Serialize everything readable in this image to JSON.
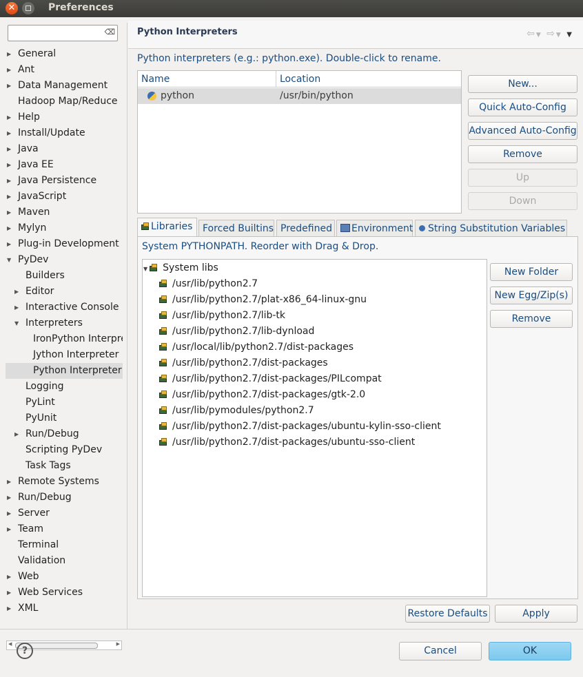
{
  "window": {
    "title": "Preferences"
  },
  "filter": {
    "placeholder": ""
  },
  "tree": [
    {
      "label": "General",
      "indent": 0,
      "arrow": "right"
    },
    {
      "label": "Ant",
      "indent": 0,
      "arrow": "right"
    },
    {
      "label": "Data Management",
      "indent": 0,
      "arrow": "right"
    },
    {
      "label": "Hadoop Map/Reduce",
      "indent": 0,
      "arrow": ""
    },
    {
      "label": "Help",
      "indent": 0,
      "arrow": "right"
    },
    {
      "label": "Install/Update",
      "indent": 0,
      "arrow": "right"
    },
    {
      "label": "Java",
      "indent": 0,
      "arrow": "right"
    },
    {
      "label": "Java EE",
      "indent": 0,
      "arrow": "right"
    },
    {
      "label": "Java Persistence",
      "indent": 0,
      "arrow": "right"
    },
    {
      "label": "JavaScript",
      "indent": 0,
      "arrow": "right"
    },
    {
      "label": "Maven",
      "indent": 0,
      "arrow": "right"
    },
    {
      "label": "Mylyn",
      "indent": 0,
      "arrow": "right"
    },
    {
      "label": "Plug-in Development",
      "indent": 0,
      "arrow": "right"
    },
    {
      "label": "PyDev",
      "indent": 0,
      "arrow": "down"
    },
    {
      "label": "Builders",
      "indent": 1,
      "arrow": ""
    },
    {
      "label": "Editor",
      "indent": 1,
      "arrow": "right"
    },
    {
      "label": "Interactive Console",
      "indent": 1,
      "arrow": "right"
    },
    {
      "label": "Interpreters",
      "indent": 1,
      "arrow": "down"
    },
    {
      "label": "IronPython Interpreter",
      "indent": 2,
      "arrow": ""
    },
    {
      "label": "Jython Interpreter",
      "indent": 2,
      "arrow": ""
    },
    {
      "label": "Python Interpreter",
      "indent": 2,
      "arrow": "",
      "selected": true
    },
    {
      "label": "Logging",
      "indent": 1,
      "arrow": ""
    },
    {
      "label": "PyLint",
      "indent": 1,
      "arrow": ""
    },
    {
      "label": "PyUnit",
      "indent": 1,
      "arrow": ""
    },
    {
      "label": "Run/Debug",
      "indent": 1,
      "arrow": "right"
    },
    {
      "label": "Scripting PyDev",
      "indent": 1,
      "arrow": ""
    },
    {
      "label": "Task Tags",
      "indent": 1,
      "arrow": ""
    },
    {
      "label": "Remote Systems",
      "indent": 0,
      "arrow": "right"
    },
    {
      "label": "Run/Debug",
      "indent": 0,
      "arrow": "right"
    },
    {
      "label": "Server",
      "indent": 0,
      "arrow": "right"
    },
    {
      "label": "Team",
      "indent": 0,
      "arrow": "right"
    },
    {
      "label": "Terminal",
      "indent": 0,
      "arrow": ""
    },
    {
      "label": "Validation",
      "indent": 0,
      "arrow": ""
    },
    {
      "label": "Web",
      "indent": 0,
      "arrow": "right"
    },
    {
      "label": "Web Services",
      "indent": 0,
      "arrow": "right"
    },
    {
      "label": "XML",
      "indent": 0,
      "arrow": "right"
    }
  ],
  "page": {
    "title": "Python Interpreters",
    "description": "Python interpreters (e.g.: python.exe).  Double-click to rename."
  },
  "interpreters": {
    "columns": [
      "Name",
      "Location"
    ],
    "rows": [
      {
        "name": "python",
        "location": "/usr/bin/python"
      }
    ]
  },
  "side_buttons": {
    "new": "New...",
    "quick": "Quick Auto-Config",
    "advanced": "Advanced Auto-Config",
    "remove": "Remove",
    "up": "Up",
    "down": "Down"
  },
  "tabs": [
    "Libraries",
    "Forced Builtins",
    "Predefined",
    "Environment",
    "String Substitution Variables"
  ],
  "libraries": {
    "description": "System PYTHONPATH.   Reorder with Drag & Drop.",
    "root": "System libs",
    "paths": [
      "/usr/lib/python2.7",
      "/usr/lib/python2.7/plat-x86_64-linux-gnu",
      "/usr/lib/python2.7/lib-tk",
      "/usr/lib/python2.7/lib-dynload",
      "/usr/local/lib/python2.7/dist-packages",
      "/usr/lib/python2.7/dist-packages",
      "/usr/lib/python2.7/dist-packages/PILcompat",
      "/usr/lib/python2.7/dist-packages/gtk-2.0",
      "/usr/lib/pymodules/python2.7",
      "/usr/lib/python2.7/dist-packages/ubuntu-kylin-sso-client",
      "/usr/lib/python2.7/dist-packages/ubuntu-sso-client"
    ],
    "buttons": {
      "new_folder": "New Folder",
      "new_egg": "New Egg/Zip(s)",
      "remove": "Remove"
    }
  },
  "footer": {
    "restore": "Restore Defaults",
    "apply": "Apply",
    "cancel": "Cancel",
    "ok": "OK",
    "help": "?"
  },
  "colors": {
    "accent": "#1a4c80",
    "ok_button": "#7cc9ee",
    "close_button": "#df4a16"
  }
}
